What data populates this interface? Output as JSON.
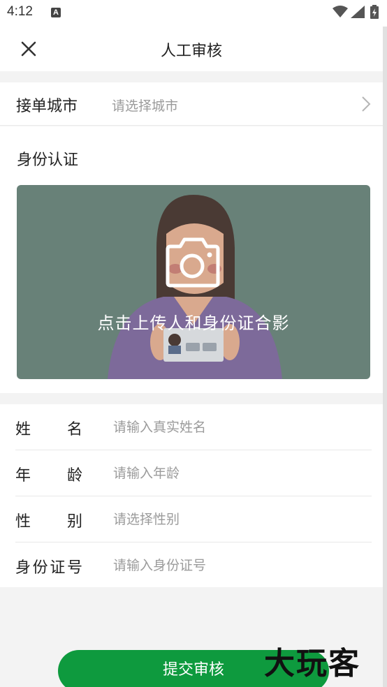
{
  "status_bar": {
    "time": "4:12",
    "notification_icon": "A"
  },
  "nav": {
    "title": "人工审核",
    "close_icon": "close-icon"
  },
  "city": {
    "label": "接单城市",
    "placeholder": "请选择城市"
  },
  "identity": {
    "title": "身份认证",
    "upload_text": "点击上传人和身份证合影"
  },
  "form": {
    "name": {
      "label": "姓名",
      "placeholder": "请输入真实姓名"
    },
    "age": {
      "label": "年龄",
      "placeholder": "请输入年龄"
    },
    "gender": {
      "label": "性别",
      "placeholder": "请选择性别"
    },
    "id_number": {
      "label": "身份证号",
      "placeholder": "请输入身份证号"
    }
  },
  "submit_label": "提交审核",
  "watermark": "大玩客",
  "colors": {
    "primary": "#0e9a3e",
    "card": "#688178"
  }
}
